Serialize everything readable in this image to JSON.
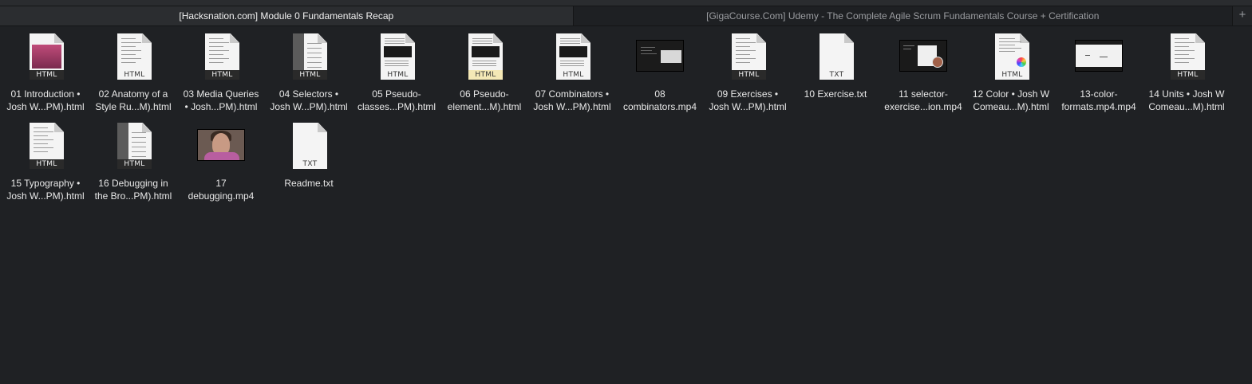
{
  "tabs": [
    {
      "label": "[Hacksnation.com] Module 0 Fundamentals Recap",
      "active": true
    },
    {
      "label": "[GigaCourse.Com] Udemy - The Complete Agile Scrum Fundamentals Course + Certification",
      "active": false
    }
  ],
  "add_tab_glyph": "+",
  "files": [
    {
      "name": "01 Introduction •\nJosh W...PM).html",
      "kind": "html",
      "badge": "HTML",
      "style": "pink"
    },
    {
      "name": "02 Anatomy of a\nStyle Ru...M).html",
      "kind": "html",
      "badge": "HTML",
      "style": "plain"
    },
    {
      "name": "03 Media Queries\n• Josh...PM).html",
      "kind": "html",
      "badge": "HTML",
      "style": "plain"
    },
    {
      "name": "04 Selectors •\nJosh W...PM).html",
      "kind": "html",
      "badge": "HTML",
      "style": "greyside"
    },
    {
      "name": "05 Pseudo-\nclasses...PM).html",
      "kind": "html",
      "badge": "HTML",
      "style": "darkblock"
    },
    {
      "name": "06 Pseudo-\nelement...M).html",
      "kind": "html",
      "badge": "HTML",
      "style": "darkblock-yellow"
    },
    {
      "name": "07 Combinators •\nJosh W...PM).html",
      "kind": "html",
      "badge": "HTML",
      "style": "darkblock"
    },
    {
      "name": "08\ncombinators.mp4",
      "kind": "video",
      "style": "dark-code"
    },
    {
      "name": "09 Exercises •\nJosh W...PM).html",
      "kind": "html",
      "badge": "HTML",
      "style": "plain"
    },
    {
      "name": "10 Exercise.txt",
      "kind": "txt",
      "badge": "TXT"
    },
    {
      "name": "11 selector-\nexercise...ion.mp4",
      "kind": "video",
      "style": "dark-avatar"
    },
    {
      "name": "12 Color • Josh W\nComeau...M).html",
      "kind": "html",
      "badge": "HTML",
      "style": "color"
    },
    {
      "name": "13-color-\nformats.mp4.mp4",
      "kind": "video",
      "style": "light"
    },
    {
      "name": "14 Units • Josh W\nComeau...M).html",
      "kind": "html",
      "badge": "HTML",
      "style": "plain"
    },
    {
      "name": "15 Typography •\nJosh W...PM).html",
      "kind": "html",
      "badge": "HTML",
      "style": "plain"
    },
    {
      "name": "16 Debugging in\nthe Bro...PM).html",
      "kind": "html",
      "badge": "HTML",
      "style": "greyside"
    },
    {
      "name": "17\ndebugging.mp4",
      "kind": "video",
      "style": "face"
    },
    {
      "name": "Readme.txt",
      "kind": "txt",
      "badge": "TXT"
    }
  ],
  "colors": {
    "background": "#1f2124",
    "tab_active": "#2b2d30",
    "text": "#e8e8e8"
  }
}
